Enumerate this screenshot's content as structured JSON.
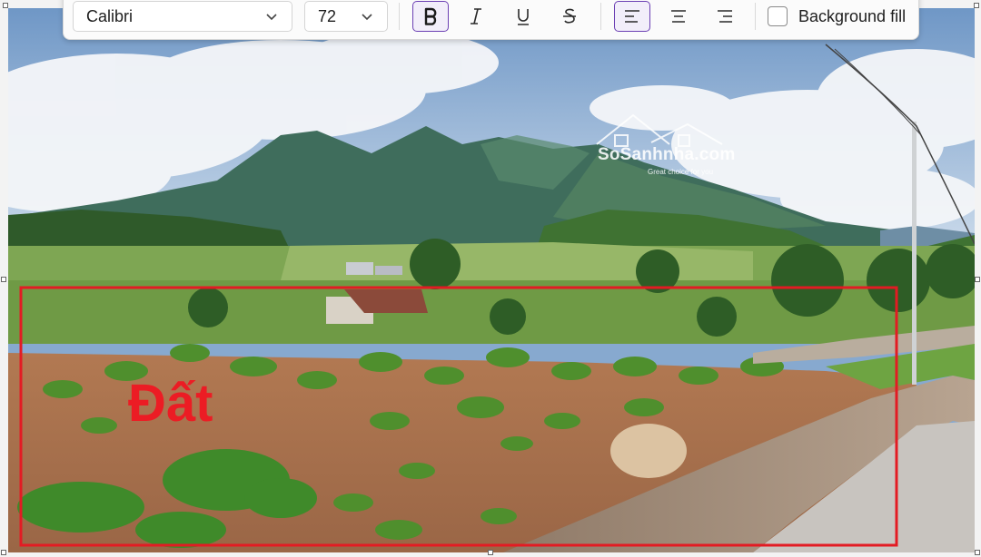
{
  "toolbar": {
    "font_family": "Calibri",
    "font_size": "72",
    "bold": {
      "icon": "bold-icon",
      "active": true
    },
    "italic": {
      "icon": "italic-icon",
      "active": false
    },
    "underline": {
      "icon": "underline-icon",
      "active": false
    },
    "strikethrough": {
      "icon": "strikethrough-icon",
      "active": false
    },
    "align_left": {
      "icon": "align-left-icon",
      "active": true
    },
    "align_center": {
      "icon": "align-center-icon",
      "active": false
    },
    "align_right": {
      "icon": "align-right-icon",
      "active": false
    },
    "background_fill": {
      "label": "Background fill",
      "checked": false
    }
  },
  "canvas": {
    "annotation_text": "Đất",
    "annotation_color": "#ec1c24",
    "rectangle_color": "#e31b23",
    "watermark": {
      "brand": "SoSanhnha.com",
      "tagline": "Great choice for you"
    }
  },
  "colors": {
    "accent": "#6b3fb3",
    "toolbar_bg": "#fbfbfb"
  }
}
